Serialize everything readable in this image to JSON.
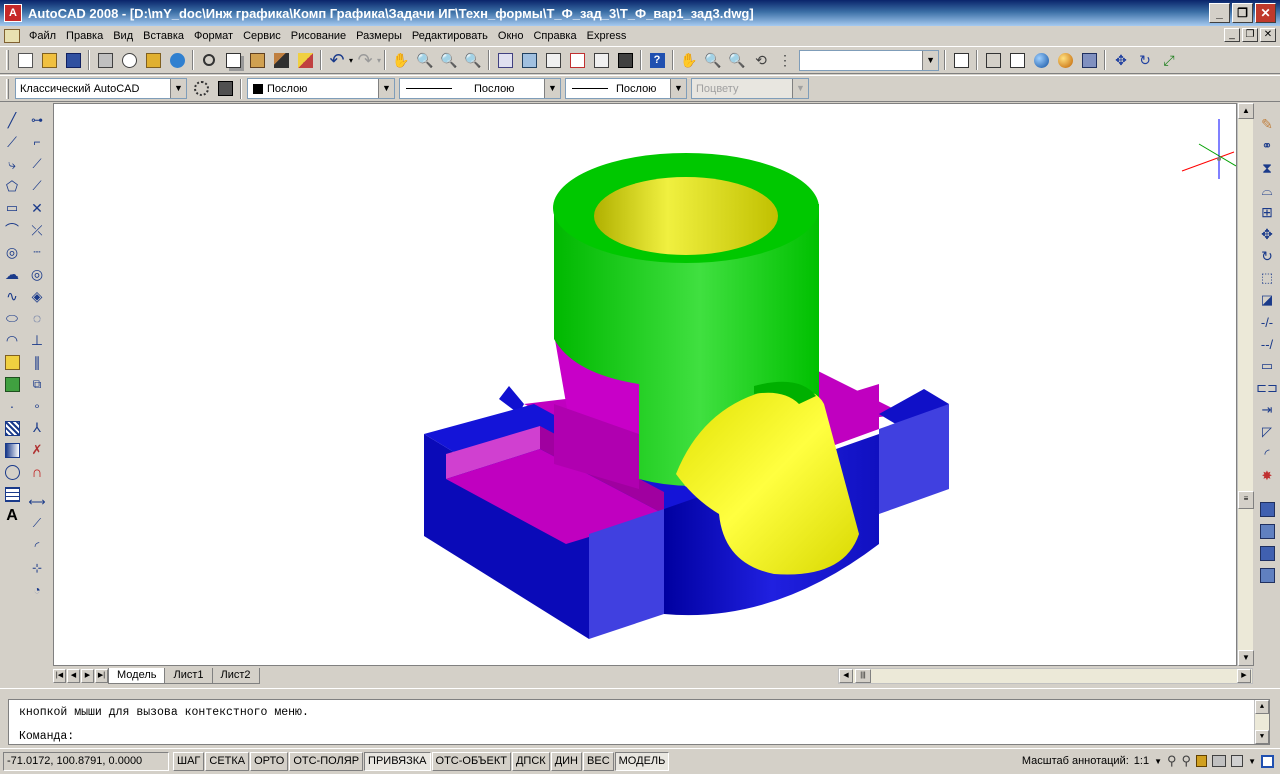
{
  "window": {
    "title": "AutoCAD 2008 - [D:\\mY_doc\\Инж графика\\Комп Графика\\Задачи ИГ\\Техн_формы\\Т_Ф_зад_3\\Т_Ф_вар1_зад3.dwg]",
    "app_icon": "A",
    "min_label": "_",
    "max_label": "❐",
    "close_label": "✕"
  },
  "menu": {
    "items": [
      "Файл",
      "Правка",
      "Вид",
      "Вставка",
      "Формат",
      "Сервис",
      "Рисование",
      "Размеры",
      "Редактировать",
      "Окно",
      "Справка",
      "Express"
    ],
    "doc_min": "_",
    "doc_max": "❐",
    "doc_close": "✕"
  },
  "toolbar2": {
    "workspace": "Классический AutoCAD",
    "color": "Послою",
    "linetype": "Послою",
    "lineweight": "Послою",
    "plotstyle": "Поцвету",
    "named_view": ""
  },
  "layout_tabs": {
    "tabs": [
      "Модель",
      "Лист1",
      "Лист2"
    ],
    "active": "Модель"
  },
  "command": {
    "history_line": "кнопкой мыши для вызова контекстного меню.",
    "prompt": "Команда:"
  },
  "status": {
    "coordinates": "-71.0172, 100.8791, 0.0000",
    "toggles": [
      {
        "label": "ШАГ",
        "on": false
      },
      {
        "label": "СЕТКА",
        "on": false
      },
      {
        "label": "ОРТО",
        "on": false
      },
      {
        "label": "ОТС-ПОЛЯР",
        "on": false
      },
      {
        "label": "ПРИВЯЗКА",
        "on": true
      },
      {
        "label": "ОТС-ОБЪЕКТ",
        "on": false
      },
      {
        "label": "ДПСК",
        "on": false
      },
      {
        "label": "ДИН",
        "on": false
      },
      {
        "label": "ВЕС",
        "on": false
      },
      {
        "label": "МОДЕЛЬ",
        "on": true
      }
    ],
    "annotation_scale_label": "Масштаб аннотаций:",
    "annotation_scale_value": "1:1"
  },
  "colors": {
    "green": "#00cc00",
    "magenta": "#c800c8",
    "blue": "#1010d0",
    "yellow": "#f0f000"
  }
}
